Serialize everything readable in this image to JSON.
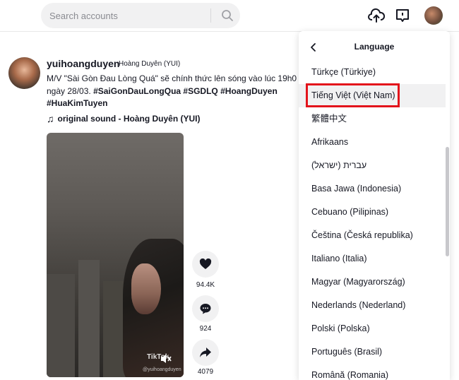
{
  "search": {
    "placeholder": "Search accounts"
  },
  "post": {
    "username": "yuihoangduyen",
    "nickname": "Hoàng Duyên (YUI)",
    "caption_text": "M/V \"Sài Gòn Đau Lòng Quá\" sẽ chính thức lên sóng vào lúc 19h0",
    "caption_text2": "ngày 28/03. ",
    "tags": [
      "#SaiGonDauLongQua",
      "#SGDLQ",
      "#HoangDuyen",
      "#HuaKimTuyen"
    ],
    "sound": "original sound - Hoàng Duyên (YUI)"
  },
  "video": {
    "watermark": "TikTok",
    "watermark_user": "@yuihoangduyen"
  },
  "actions": {
    "likes": "94.4K",
    "comments": "924",
    "shares": "4079"
  },
  "language_menu": {
    "title": "Language",
    "items": [
      "Türkçe (Türkiye)",
      "Tiếng Việt (Việt Nam)",
      "繁體中文",
      "Afrikaans",
      "עברית (ישראל)",
      "Basa Jawa (Indonesia)",
      "Cebuano (Pilipinas)",
      "Čeština (Česká republika)",
      "Italiano (Italia)",
      "Magyar (Magyarország)",
      "Nederlands (Nederland)",
      "Polski (Polska)",
      "Português (Brasil)",
      "Română (Romania)"
    ],
    "selected_index": 1,
    "highlight_color": "#e3131b"
  },
  "colors": {
    "text": "#161823",
    "muted": "#8a8b91",
    "surface": "#f1f1f2"
  }
}
